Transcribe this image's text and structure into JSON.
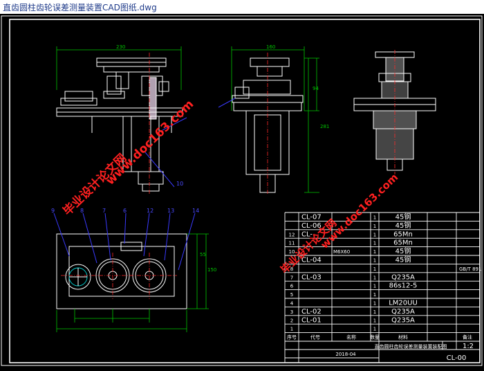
{
  "window": {
    "title": "直齿圆柱齿轮误差测量装置CAD图纸.dwg"
  },
  "dims": {
    "front_width": "230",
    "side_width": "160",
    "side_h1": "94",
    "side_h2": "281",
    "plan_h1": "55",
    "plan_h2": "150"
  },
  "balloons": [
    "9",
    "8",
    "7",
    "6",
    "5",
    "4",
    "3",
    "2",
    "1",
    "10",
    "11",
    "12",
    "13",
    "14"
  ],
  "bom": {
    "rows": [
      {
        "no": "",
        "code": "CL-07",
        "name": "",
        "qty": "1",
        "material": "45钢",
        "note": ""
      },
      {
        "no": "",
        "code": "CL-06",
        "name": "",
        "qty": "1",
        "material": "45钢",
        "note": ""
      },
      {
        "no": "12",
        "code": "CL-",
        "name": "",
        "qty": "1",
        "material": "65Mn",
        "note": ""
      },
      {
        "no": "11",
        "code": "",
        "name": "",
        "qty": "1",
        "material": "65Mn",
        "note": ""
      },
      {
        "no": "10",
        "code": "",
        "name": "M6X60",
        "qty": "1",
        "material": "45钢",
        "note": ""
      },
      {
        "no": "",
        "code": "CL-04",
        "name": "",
        "qty": "1",
        "material": "45钢",
        "note": ""
      },
      {
        "no": "8",
        "code": "",
        "name": "",
        "qty": "1",
        "material": "",
        "note": "GB/T 891"
      },
      {
        "no": "7",
        "code": "CL-03",
        "name": "",
        "qty": "1",
        "material": "Q235A",
        "note": ""
      },
      {
        "no": "6",
        "code": "",
        "name": "",
        "qty": "1",
        "material": "86s12-5",
        "note": ""
      },
      {
        "no": "5",
        "code": "",
        "name": "",
        "qty": "1",
        "material": "",
        "note": ""
      },
      {
        "no": "4",
        "code": "",
        "name": "",
        "qty": "1",
        "material": "LM20UU",
        "note": ""
      },
      {
        "no": "3",
        "code": "CL-02",
        "name": "",
        "qty": "1",
        "material": "Q235A",
        "note": ""
      },
      {
        "no": "2",
        "code": "CL-01",
        "name": "",
        "qty": "1",
        "material": "Q235A",
        "note": ""
      },
      {
        "no": "1",
        "code": "",
        "name": "",
        "qty": "1",
        "material": "",
        "note": ""
      }
    ],
    "header": {
      "no": "序号",
      "code": "代号",
      "name": "名称",
      "qty": "数量",
      "material": "材料",
      "note": "备注"
    },
    "date": "2018-04",
    "drawing_title": "直齿圆柱齿轮误差测量装置装配图",
    "scale": "1:2",
    "drawing_no": "CL-00"
  },
  "watermarks": [
    "毕业设计论文网",
    "www.doc163.com"
  ],
  "colors": {
    "line": "#ffffff",
    "dim": "#00c800",
    "center": "#ff2a2a",
    "leader": "#3a3aff",
    "cyan": "#00d8d8",
    "watermark": "#ff2020"
  }
}
